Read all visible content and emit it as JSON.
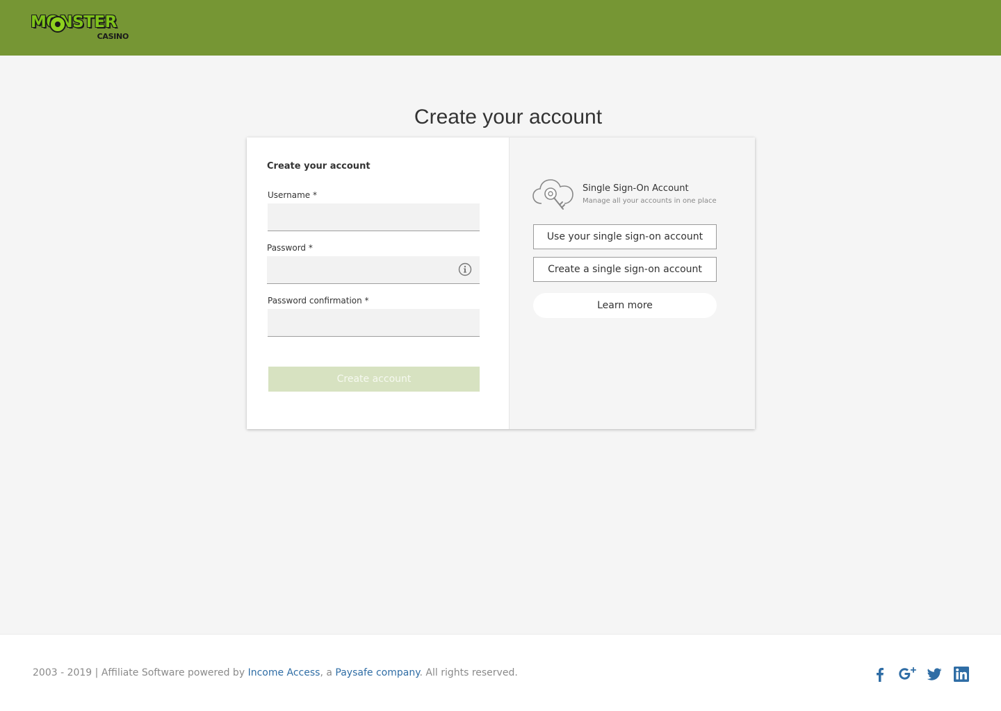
{
  "brand": {
    "logo_main": "MONSTER",
    "logo_sub": "CASINO",
    "color_header": "#769634"
  },
  "page": {
    "title": "Create your account"
  },
  "form": {
    "heading": "Create your account",
    "username_label": "Username *",
    "password_label": "Password *",
    "password_confirmation_label": "Password confirmation *",
    "username_value": "",
    "password_value": "",
    "password_confirmation_value": "",
    "submit_label": "Create account",
    "password_info_icon": "info-circle-icon"
  },
  "sso": {
    "icon": "cloud-key-icon",
    "title": "Single Sign-On Account",
    "subtitle": "Manage all your accounts in one place",
    "use_button": "Use your single sign-on account",
    "create_button": "Create a single sign-on account",
    "learn_more": "Learn more"
  },
  "footer": {
    "prefix": "2003 - 2019 | Affiliate Software powered by ",
    "link1": "Income Access",
    "middle": ", a ",
    "link2": "Paysafe company",
    "suffix": ". All rights reserved.",
    "social": [
      "facebook-icon",
      "google-plus-icon",
      "twitter-icon",
      "linkedin-icon"
    ],
    "social_color": "#2f6da5"
  }
}
